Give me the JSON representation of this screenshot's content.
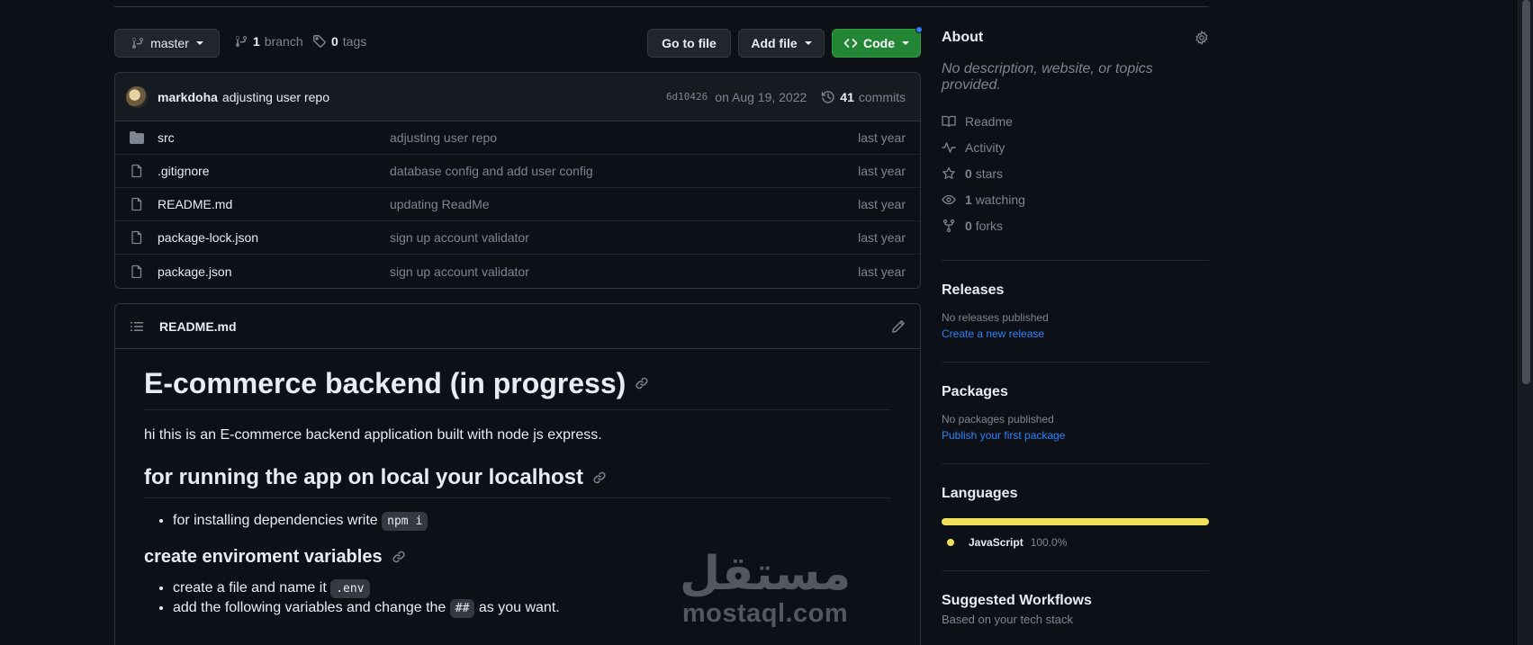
{
  "branch_bar": {
    "branch_name": "master",
    "branch_count": "1",
    "branch_label": "branch",
    "tag_count": "0",
    "tag_label": "tags",
    "go_to_file": "Go to file",
    "add_file": "Add file",
    "code": "Code"
  },
  "latest_commit": {
    "author": "markdoha",
    "message": "adjusting user repo",
    "sha": "6d10426",
    "date": "on Aug 19, 2022",
    "commit_count": "41",
    "commit_label": "commits"
  },
  "files": [
    {
      "name": "src",
      "type": "folder",
      "message": "adjusting user repo",
      "time": "last year"
    },
    {
      "name": ".gitignore",
      "type": "file",
      "message": "database config and add user config",
      "time": "last year"
    },
    {
      "name": "README.md",
      "type": "file",
      "message": "updating ReadMe",
      "time": "last year"
    },
    {
      "name": "package-lock.json",
      "type": "file",
      "message": "sign up account validator",
      "time": "last year"
    },
    {
      "name": "package.json",
      "type": "file",
      "message": "sign up account validator",
      "time": "last year"
    }
  ],
  "readme": {
    "filename": "README.md",
    "h1": "E-commerce backend (in progress)",
    "intro": "hi this is an E-commerce backend application built with node js express.",
    "h2": "for running the app on local your localhost",
    "install_text": "for installing dependencies write",
    "install_code": "npm i",
    "h3": "create enviroment variables",
    "env_item1_text": "create a file and name it",
    "env_item1_code": ".env",
    "env_item2_pre": "add the following variables and change the",
    "env_item2_code": "##",
    "env_item2_post": "as you want."
  },
  "watermark": {
    "arabic": "مستقل",
    "latin": "mostaql.com"
  },
  "about": {
    "heading": "About",
    "description": "No description, website, or topics provided.",
    "readme": "Readme",
    "activity": "Activity",
    "stars_count": "0",
    "stars_label": "stars",
    "watching_count": "1",
    "watching_label": "watching",
    "forks_count": "0",
    "forks_label": "forks"
  },
  "releases": {
    "heading": "Releases",
    "empty": "No releases published",
    "link": "Create a new release"
  },
  "packages": {
    "heading": "Packages",
    "empty": "No packages published",
    "link": "Publish your first package"
  },
  "languages": {
    "heading": "Languages",
    "items": [
      {
        "name": "JavaScript",
        "percent": "100.0%",
        "color": "#f1e05a"
      }
    ]
  },
  "workflows": {
    "heading": "Suggested Workflows",
    "sub": "Based on your tech stack"
  }
}
